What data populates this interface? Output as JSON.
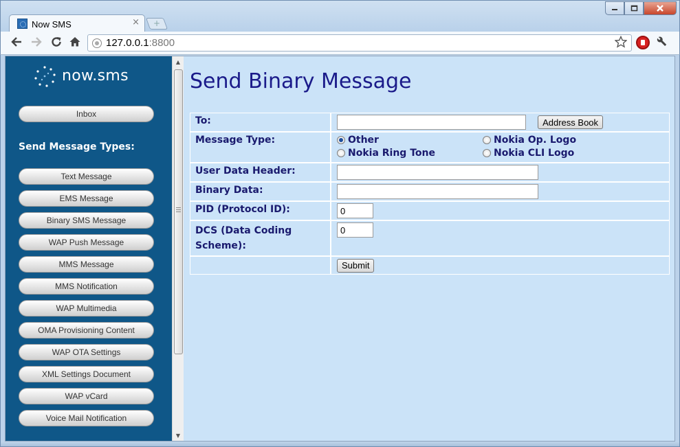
{
  "browser": {
    "tab_title": "Now SMS",
    "tab_close_glyph": "×",
    "new_tab_glyph": "+",
    "url_host": "127.0.0.1",
    "url_port": ":8800",
    "icons": {
      "back": "back-arrow-icon",
      "forward": "forward-arrow-icon",
      "reload": "reload-icon",
      "home": "home-icon",
      "bookmark": "star-icon",
      "stop": "stop-sign-icon",
      "menu": "wrench-icon"
    },
    "window_buttons": [
      "minimize",
      "maximize",
      "close"
    ]
  },
  "sidebar": {
    "logo_text": "now.sms",
    "inbox_label": "Inbox",
    "heading": "Send Message Types:",
    "items": [
      "Text Message",
      "EMS Message",
      "Binary SMS Message",
      "WAP Push Message",
      "MMS Message",
      "MMS Notification",
      "WAP Multimedia",
      "OMA Provisioning Content",
      "WAP OTA Settings",
      "XML Settings Document",
      "WAP vCard",
      "Voice Mail Notification"
    ],
    "background_color": "#0f5788"
  },
  "main": {
    "title": "Send Binary Message",
    "form": {
      "to_label": "To:",
      "to_value": "",
      "address_book_label": "Address Book",
      "message_type_label": "Message Type:",
      "message_types": [
        {
          "label": "Other",
          "checked": true
        },
        {
          "label": "Nokia Op. Logo",
          "checked": false
        },
        {
          "label": "Nokia Ring Tone",
          "checked": false
        },
        {
          "label": "Nokia CLI Logo",
          "checked": false
        }
      ],
      "udh_label": "User Data Header:",
      "udh_value": "",
      "binary_label": "Binary Data:",
      "binary_value": "",
      "pid_label": "PID (Protocol ID):",
      "pid_value": "0",
      "dcs_label": "DCS (Data Coding Scheme):",
      "dcs_value": "0",
      "submit_label": "Submit"
    },
    "title_color": "#1b1b8a",
    "background_color": "#cbe3f8"
  }
}
